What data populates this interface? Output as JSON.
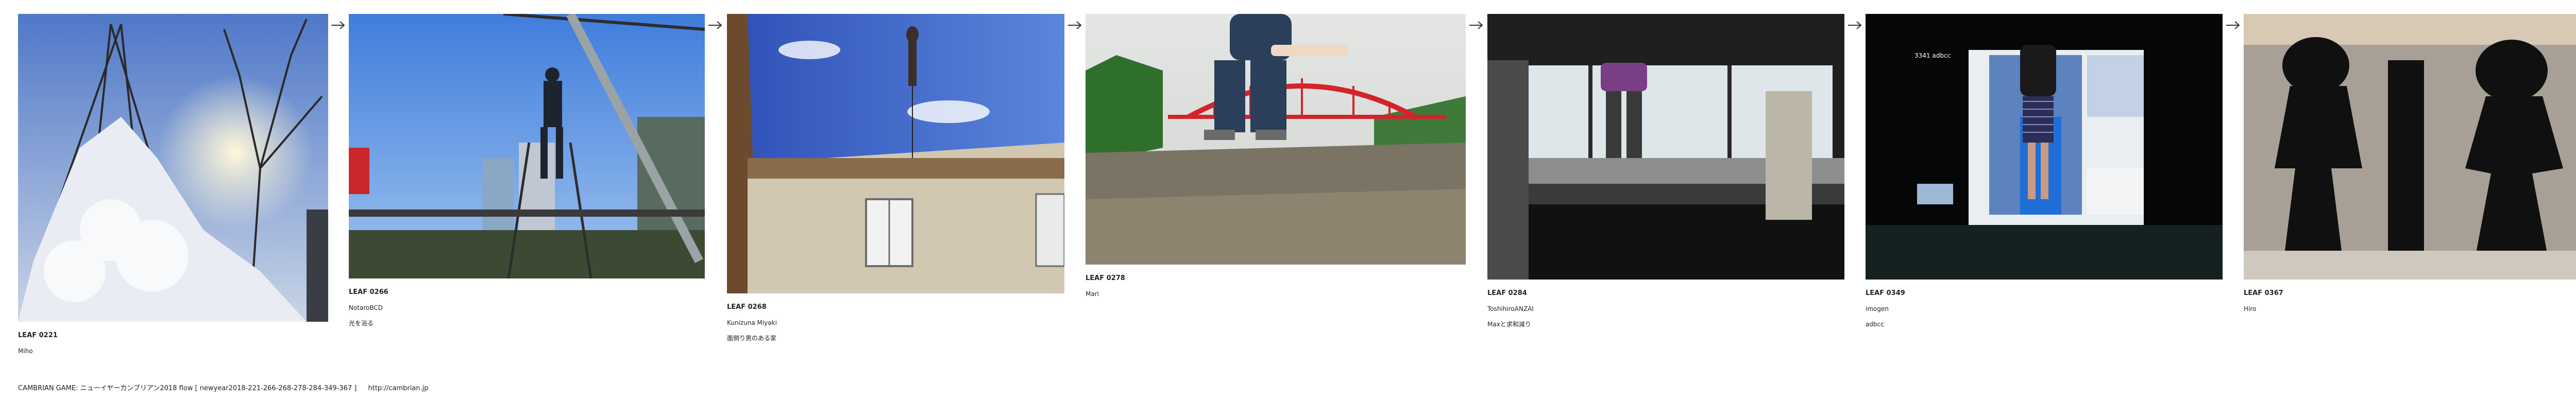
{
  "leaves": [
    {
      "id": "LEAF 0221",
      "name": "Miho",
      "title": ""
    },
    {
      "id": "LEAF 0266",
      "name": "NotaroBCD",
      "title": "光を浴る"
    },
    {
      "id": "LEAF 0268",
      "name": "Kunizuna Miyaki",
      "title": "面倒り男のある家"
    },
    {
      "id": "LEAF 0278",
      "name": "Mari",
      "title": ""
    },
    {
      "id": "LEAF 0284",
      "name": "ToshihiroANZAI",
      "title": "Maxと求和減り"
    },
    {
      "id": "LEAF 0349",
      "name": "imogen",
      "title": "adbcc"
    },
    {
      "id": "LEAF 0367",
      "name": "Hiro",
      "title": ""
    }
  ],
  "footer": {
    "text": "CAMBRIAN GAME: ニューイヤーカンブリアン2018  flow [ newyear2018-221-266-268-278-284-349-367 ]",
    "link": "http://cambrian.jp"
  },
  "overlay_text": {
    "screen_label": "3341 adbcc"
  }
}
